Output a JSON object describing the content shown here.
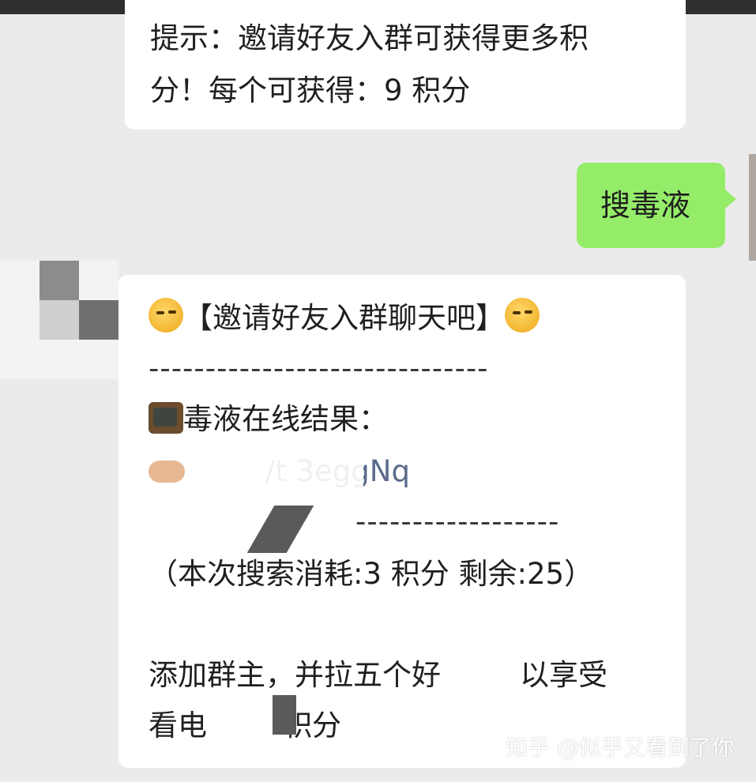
{
  "top_message": {
    "line1": "提示：邀请好友入群可获得更多积",
    "line2": "分！每个可获得：9 积分"
  },
  "my_message": {
    "text": "搜毒液"
  },
  "bot_message": {
    "header": "【邀请好友入群聊天吧】",
    "divider_top": "------------------------------",
    "result_title": "毒液在线结果：",
    "link_partial": "/t        3eggNq",
    "divider_bottom": "------------------",
    "cost_line": "（本次搜索消耗:3 积分 剩余:25）",
    "promo_line1": "添加群主，并拉五个好",
    "promo_line1_end": "以享受",
    "promo_line2": "看电",
    "promo_line2_end": "积分"
  },
  "watermark": "知乎 @似乎又看到了你",
  "colors": {
    "background": "#ebebeb",
    "bubble_white": "#ffffff",
    "bubble_green": "#95ec69",
    "link": "#5b6b8c"
  },
  "icons": [
    "thinking-face-icon",
    "television-icon",
    "pointing-hand-icon"
  ]
}
